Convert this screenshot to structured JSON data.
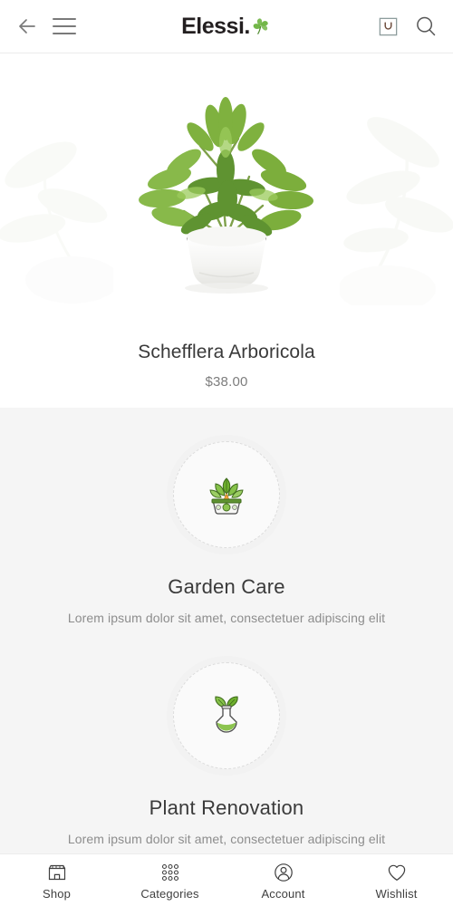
{
  "header": {
    "back_icon": "arrow-left-icon",
    "menu_icon": "hamburger-menu-icon",
    "logo_text": "Elessi.",
    "logo_mark": "clover-leaf-icon",
    "cart_icon": "shopping-bag-icon",
    "search_icon": "search-icon"
  },
  "product": {
    "title": "Schefflera Arboricola",
    "price": "$38.00",
    "image_alt": "schefflera-plant-in-white-pot"
  },
  "features": [
    {
      "icon": "plant-basket-icon",
      "title": "Garden Care",
      "description": "Lorem ipsum dolor sit amet, consectetuer adipiscing elit"
    },
    {
      "icon": "plant-flask-icon",
      "title": "Plant Renovation",
      "description": "Lorem ipsum dolor sit amet, consectetuer adipiscing elit"
    }
  ],
  "bottom_nav": [
    {
      "icon": "storefront-icon",
      "label": "Shop"
    },
    {
      "icon": "grid-dots-icon",
      "label": "Categories"
    },
    {
      "icon": "user-circle-icon",
      "label": "Account"
    },
    {
      "icon": "heart-icon",
      "label": "Wishlist"
    }
  ],
  "colors": {
    "brand_green": "#6cb33f",
    "text_dark": "#3a3a3a",
    "text_muted": "#8d8d8d",
    "section_bg": "#f5f5f5",
    "border": "#ececec"
  }
}
